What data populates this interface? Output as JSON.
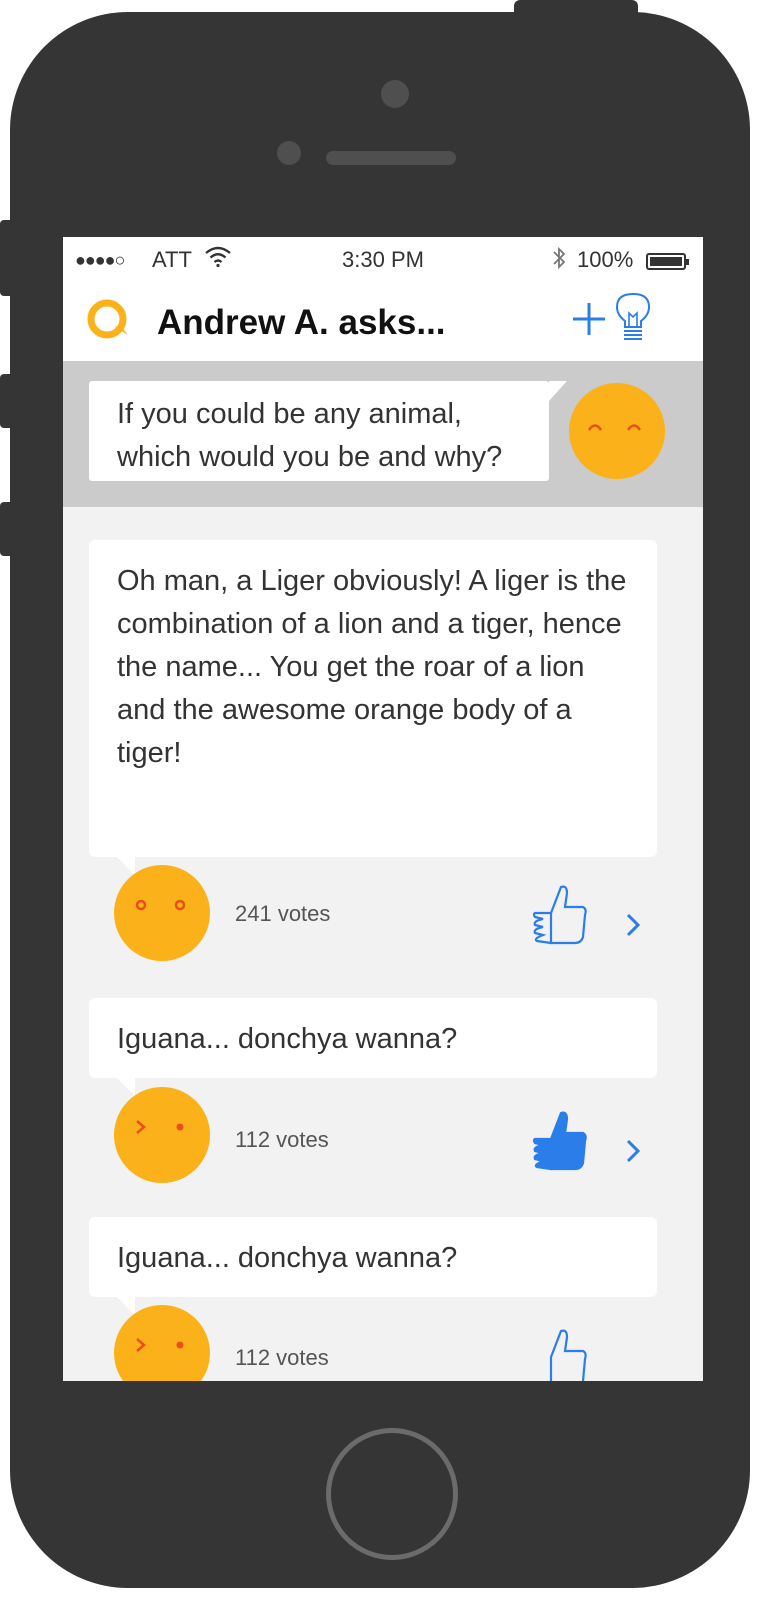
{
  "status_bar": {
    "signal": "●●●●○",
    "carrier": "ATT",
    "time": "3:30 PM",
    "battery": "100%"
  },
  "header": {
    "title": "Andrew A. asks...",
    "icons": [
      "logo-icon",
      "plus-icon",
      "lightbulb-icon"
    ]
  },
  "question": {
    "text": "If you could be any animal,\nwhich would you be and why?"
  },
  "answers": [
    {
      "text": "Oh man, a Liger obviously! A liger is the combination of a lion and a tiger, hence the name... You get the roar of a lion and the awesome orange body of a tiger!",
      "votes": "241 votes",
      "liked": false
    },
    {
      "text": "Iguana... donchya wanna?",
      "votes": "112 votes",
      "liked": true
    },
    {
      "text": "Iguana... donchya wanna?",
      "votes": "112 votes",
      "liked": false
    }
  ],
  "colors": {
    "accent": "#2b7de9",
    "avatar": "#fbb11a",
    "face": "#e94e1b",
    "question_bg": "#cbcbcb",
    "feed_bg": "#f2f2f2",
    "frame": "#353535"
  }
}
